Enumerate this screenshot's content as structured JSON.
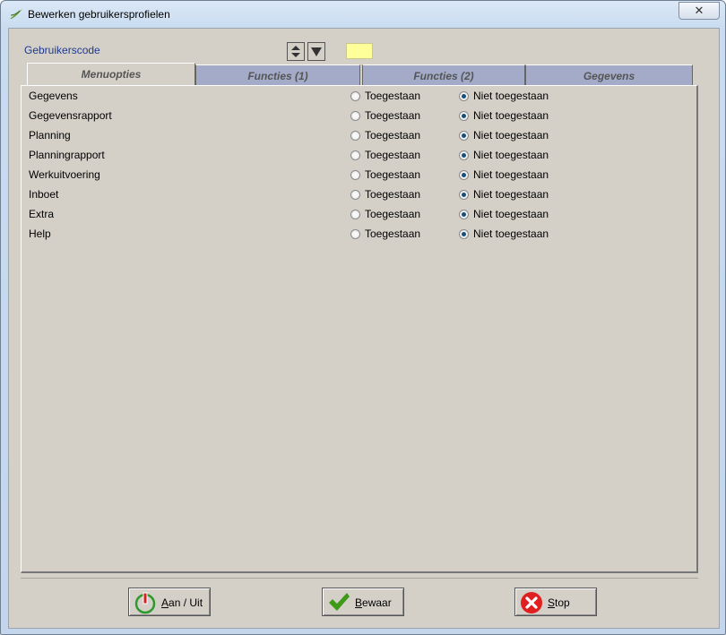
{
  "window": {
    "title": "Bewerken gebruikersprofielen",
    "close_label": "✕"
  },
  "header": {
    "code_label": "Gebruikerscode",
    "code_value": ""
  },
  "tabs": [
    {
      "label": "Menuopties",
      "active": true
    },
    {
      "label": "Functies (1)",
      "active": false
    },
    {
      "label": "Functies (2)",
      "active": false
    },
    {
      "label": "Gegevens",
      "active": false
    }
  ],
  "options": {
    "allowed_label": "Toegestaan",
    "denied_label": "Niet toegestaan",
    "rows": [
      {
        "label": "Gegevens",
        "selected": "denied"
      },
      {
        "label": "Gegevensrapport",
        "selected": "denied"
      },
      {
        "label": "Planning",
        "selected": "denied"
      },
      {
        "label": "Planningrapport",
        "selected": "denied"
      },
      {
        "label": "Werkuitvoering",
        "selected": "denied"
      },
      {
        "label": "Inboet",
        "selected": "denied"
      },
      {
        "label": "Extra",
        "selected": "denied"
      },
      {
        "label": "Help",
        "selected": "denied"
      }
    ]
  },
  "buttons": {
    "toggle": "Aan / Uit",
    "save": "Bewaar",
    "stop": "Stop"
  },
  "colors": {
    "field_yellow": "#ffff99",
    "tab_inactive": "#a3abc8",
    "radio_dot": "#14507a"
  }
}
